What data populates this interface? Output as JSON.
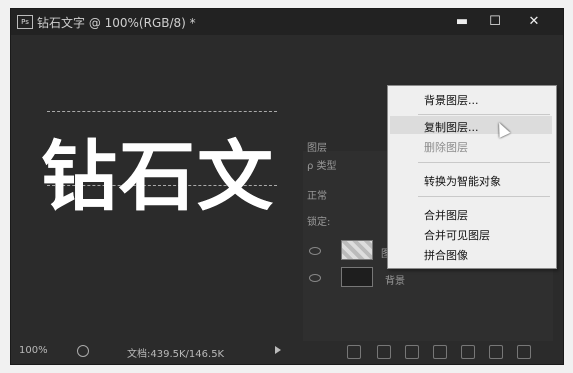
{
  "window": {
    "title": "钻石文字 @ 100%(RGB/8) *",
    "app_icon": "Ps",
    "controls": {
      "minimize": "▬",
      "maximize": "☐",
      "close": "✕"
    }
  },
  "canvas": {
    "text": "钻石文"
  },
  "layers_panel": {
    "title": "图层",
    "filter_label": "ρ 类型",
    "mode_label": "正常",
    "lock_label": "锁定:",
    "layer_text": "背景",
    "layer_partial": "图"
  },
  "context_menu": {
    "items": [
      {
        "label": "背景图层...",
        "state": "normal"
      },
      {
        "label": "复制图层...",
        "state": "highlighted"
      },
      {
        "label": "删除图层",
        "state": "disabled"
      },
      {
        "label": "转换为智能对象",
        "state": "normal"
      },
      {
        "label": "合并图层",
        "state": "normal"
      },
      {
        "label": "合并可见图层",
        "state": "normal"
      },
      {
        "label": "拼合图像",
        "state": "normal"
      }
    ]
  },
  "status": {
    "zoom": "100%",
    "doc_info": "文档:439.5K/146.5K"
  }
}
